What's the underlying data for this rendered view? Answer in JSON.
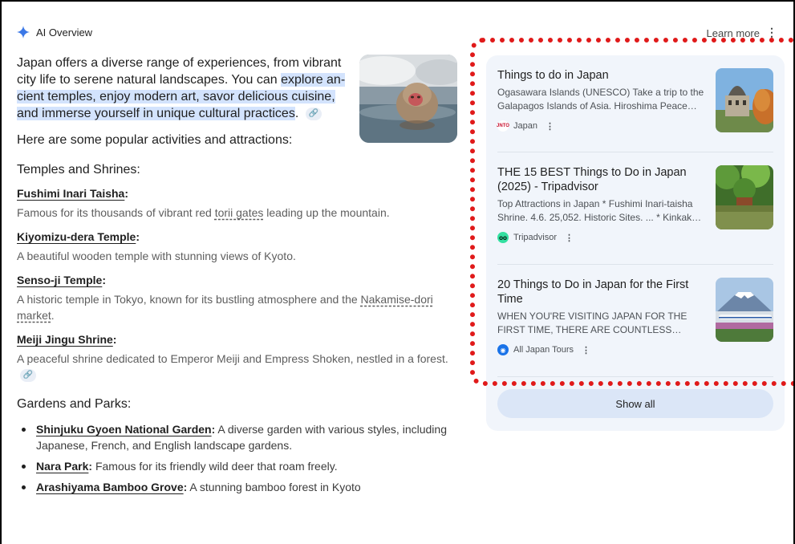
{
  "header": {
    "title": "AI Overview",
    "learn_more": "Learn more",
    "more": "⋮"
  },
  "intro": {
    "text_before": "Japan offers a diverse range of experiences, from vibrant city life to serene natural landscapes. You can ",
    "highlight": "explore an­cient temples, enjoy modern art, savor delicious cuisine, and immerse yourself in unique cultural practices",
    "text_after": ".",
    "link_icon": "🔗"
  },
  "popular_heading": "Here are some popular activities and attractions:",
  "temples": {
    "heading": "Temples and Shrines:",
    "items": [
      {
        "name": "Fushimi Inari Taisha",
        "desc_before": "Famous for its thousands of vibrant red ",
        "desc_link": "torii gates",
        "desc_after": " leading up the mountain."
      },
      {
        "name": "Kiyomizu-dera Temple",
        "desc": "A beautiful wooden temple with stunning views of Kyoto."
      },
      {
        "name": "Senso-ji Temple",
        "desc_before": "A historic temple in Tokyo, known for its bustling atmosphere and the ",
        "desc_link": "Nakamise-dori market",
        "desc_after": "."
      },
      {
        "name": "Meiji Jingu Shrine",
        "desc": "A peaceful shrine dedicated to Emperor Meiji and Empress Shoken, nestled in a forest."
      }
    ]
  },
  "gardens": {
    "heading": "Gardens and Parks:",
    "items": [
      {
        "name": "Shinjuku Gyoen National Garden",
        "desc": " A diverse garden with various styles, including Japanese, French, and English landscape gardens."
      },
      {
        "name": "Nara Park",
        "desc": " Famous for its friendly wild deer that roam freely."
      },
      {
        "name": "Arashiyama Bamboo Grove",
        "desc": " A stunning bamboo forest in Kyoto"
      }
    ]
  },
  "sources": {
    "cards": [
      {
        "title": "Things to do in Japan",
        "snippet": "Ogasawara Islands (UNESCO) Take a trip to the Galapagos Islands of Asia. Hiroshima Peace…",
        "source": "Japan",
        "source_icon": "JNTO"
      },
      {
        "title": "THE 15 BEST Things to Do in Japan (2025) - Tripadvisor",
        "snippet": "Top Attractions in Japan * Fushimi Inari-taisha Shrine. 4.6. 25,052. Historic Sites. ... * Kinkak…",
        "source": "Tripadvisor",
        "source_icon": "oo"
      },
      {
        "title": "20 Things to Do in Japan for the First Time",
        "snippet": "WHEN YOU'RE VISITING JAPAN FOR THE FIRST TIME, THERE ARE COUNTLESS…",
        "source": "All Japan Tours",
        "source_icon": "◉"
      }
    ],
    "more": "⋮",
    "show_all": "Show all"
  },
  "colors": {
    "highlight": "#d3e3fd",
    "panel": "#f1f5fb",
    "annotation": "#e01a1a"
  }
}
